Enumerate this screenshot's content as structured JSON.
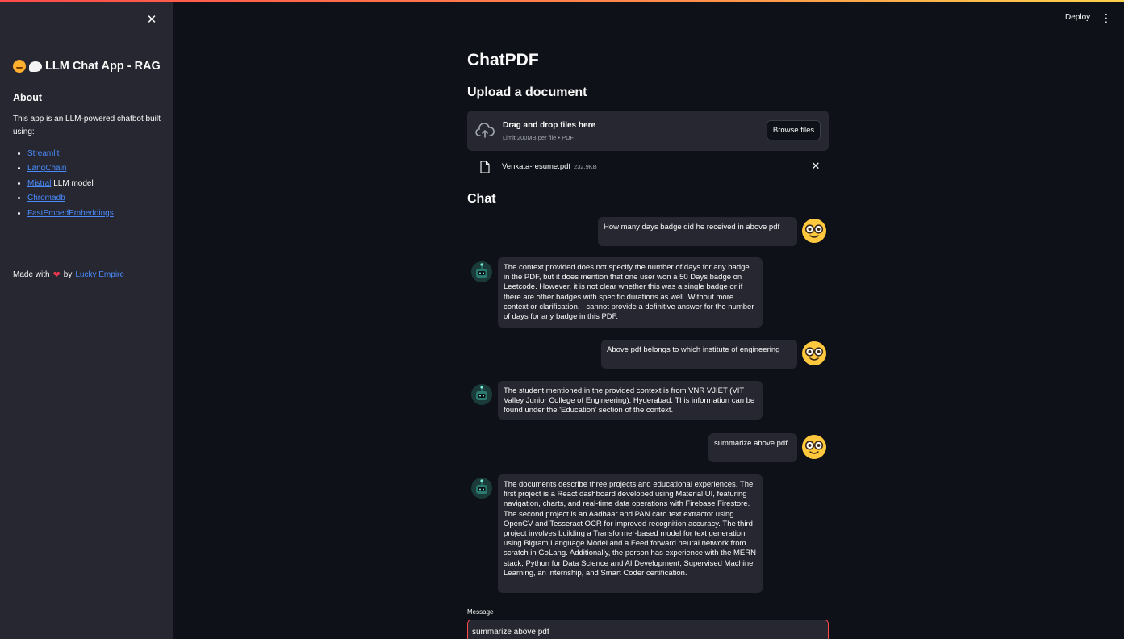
{
  "sidebar": {
    "close_symbol": "✕",
    "title": "LLM Chat App - RAG",
    "title_icons": [
      "hugging-face-icon",
      "speech-bubble-icon"
    ],
    "about_heading": "About",
    "about_text": "This app is an LLM-powered chatbot built using:",
    "links": [
      {
        "label": "Streamlit",
        "suffix": ""
      },
      {
        "label": "LangChain",
        "suffix": ""
      },
      {
        "label": "Mistral",
        "suffix": " LLM model"
      },
      {
        "label": "Chromadb",
        "suffix": ""
      },
      {
        "label": "FastEmbedEmbeddings",
        "suffix": ""
      }
    ],
    "made_with_prefix": "Made with",
    "made_with_by": "by",
    "author_link": "Lucky Empire"
  },
  "header": {
    "deploy_label": "Deploy",
    "menu_symbol": "⋮"
  },
  "main": {
    "title": "ChatPDF",
    "upload_heading": "Upload a document",
    "dropzone": {
      "text": "Drag and drop files here",
      "limit": "Limit 200MB per file • PDF",
      "browse_label": "Browse files"
    },
    "file": {
      "name": "Venkata-resume.pdf",
      "size": "232.9KB",
      "remove_symbol": "✕"
    },
    "chat_heading": "Chat",
    "messages": [
      {
        "role": "user",
        "text": "How many days badge did he received in above pdf"
      },
      {
        "role": "assistant",
        "text": "The context provided does not specify the number of days for any badge in the PDF, but it does mention that one user won a 50 Days badge on Leetcode. However, it is not clear whether this was a single badge or if there are other badges with specific durations as well. Without more context or clarification, I cannot provide a definitive answer for the number of days for any badge in this PDF."
      },
      {
        "role": "user",
        "text": "Above pdf belongs to which institute of engineering"
      },
      {
        "role": "assistant",
        "text": "The student mentioned in the provided context is from VNR VJIET (VIT Valley Junior College of Engineering), Hyderabad. This information can be found under the 'Education' section of the context."
      },
      {
        "role": "user",
        "text": "summarize above pdf"
      },
      {
        "role": "assistant",
        "text": "The documents describe three projects and educational experiences. The first project is a React dashboard developed using Material UI, featuring navigation, charts, and real-time data operations with Firebase Firestore. The second project is an Aadhaar and PAN card text extractor using OpenCV and Tesseract OCR for improved recognition accuracy. The third project involves building a Transformer-based model for text generation using Bigram Language Model and a Feed forward neural network from scratch in GoLang. Additionally, the person has experience with the MERN stack, Python for Data Science and AI Development, Supervised Machine Learning, an internship, and Smart Coder certification."
      }
    ],
    "input": {
      "label": "Message",
      "value": "summarize above pdf"
    }
  },
  "colors": {
    "background": "#0e1117",
    "sidebar": "#262730",
    "accent": "#ff4b4b",
    "link": "#4a8cff"
  }
}
